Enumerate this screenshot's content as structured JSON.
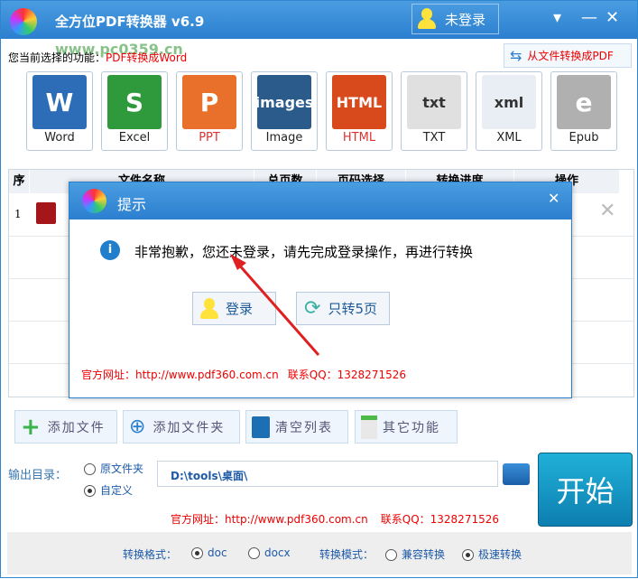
{
  "window": {
    "title": "全方位PDF转换器 v6.9",
    "login_label": "未登录",
    "watermark": "www.pc0359.cn"
  },
  "current": {
    "label": "您当前选择的功能：",
    "value": "PDF转换成Word"
  },
  "to_pdf_label": "从文件转换成PDF",
  "tools": [
    {
      "label": "Word",
      "icon": "W",
      "color": "#2d6db8"
    },
    {
      "label": "Excel",
      "icon": "S",
      "color": "#2e9a3c"
    },
    {
      "label": "PPT",
      "icon": "P",
      "color": "#e8702a"
    },
    {
      "label": "Image",
      "icon": "images",
      "color": "#2a5b8a"
    },
    {
      "label": "HTML",
      "icon": "HTML",
      "color": "#d84a1c"
    },
    {
      "label": "TXT",
      "icon": "txt",
      "color": "#e0e0e0"
    },
    {
      "label": "XML",
      "icon": "xml",
      "color": "#e8eef4"
    },
    {
      "label": "Epub",
      "icon": "e",
      "color": "#b0b0b0"
    }
  ],
  "table": {
    "headers": [
      "序",
      "文件名称",
      "总页数",
      "页码选择",
      "转换进度",
      "操作"
    ],
    "rows": [
      {
        "index": "1"
      }
    ]
  },
  "dialog": {
    "title": "提示",
    "message": "非常抱歉，您还未登录，请先完成登录操作，再进行转换",
    "login_button": "登录",
    "five_pages_button": "只转5页",
    "site": "官方网址：http://www.pdf360.com.cn",
    "qq": "联系QQ：1328271526"
  },
  "actions": [
    "添加文件",
    "添加文件夹",
    "清空列表",
    "其它功能"
  ],
  "output": {
    "label": "输出目录：",
    "opt_original": "原文件夹",
    "opt_custom": "自定义",
    "selected": "自定义",
    "path": "D:\\tools\\桌面\\"
  },
  "start_label": "开始",
  "footer": {
    "site": "官方网址：http://www.pdf360.com.cn",
    "qq": "联系QQ：1328271526"
  },
  "options": {
    "format_label": "转换格式：",
    "format_doc": "doc",
    "format_docx": "docx",
    "format_selected": "doc",
    "mode_label": "转换模式：",
    "mode_compat": "兼容转换",
    "mode_fast": "极速转换",
    "mode_selected": "极速转换"
  }
}
